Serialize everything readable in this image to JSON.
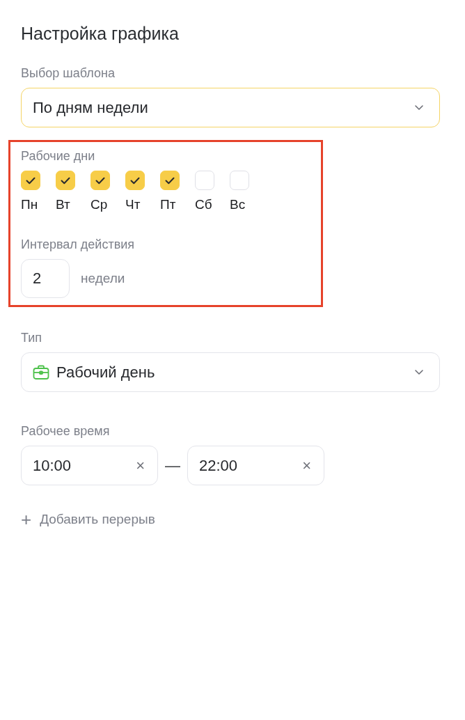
{
  "title": "Настройка графика",
  "template": {
    "label": "Выбор шаблона",
    "value": "По дням недели",
    "focused": true
  },
  "workdays": {
    "highlighted": true,
    "label": "Рабочие дни",
    "days": [
      {
        "label": "Пн",
        "checked": true
      },
      {
        "label": "Вт",
        "checked": true
      },
      {
        "label": "Ср",
        "checked": true
      },
      {
        "label": "Чт",
        "checked": true
      },
      {
        "label": "Пт",
        "checked": true
      },
      {
        "label": "Сб",
        "checked": false
      },
      {
        "label": "Вс",
        "checked": false
      }
    ],
    "interval": {
      "label": "Интервал действия",
      "value": "2",
      "unit": "недели"
    }
  },
  "type": {
    "label": "Тип",
    "value": "Рабочий день",
    "focused": false
  },
  "work_time": {
    "label": "Рабочее время",
    "from": "10:00",
    "separator": "—",
    "to": "22:00",
    "clear": "×"
  },
  "add_break": {
    "icon": "+",
    "label": "Добавить перерыв"
  }
}
